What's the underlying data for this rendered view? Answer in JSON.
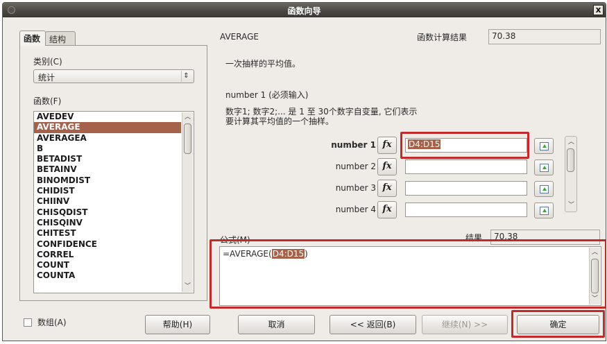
{
  "window": {
    "title": "函数向导",
    "close_glyph": "x"
  },
  "tabs": [
    {
      "label": "函数"
    },
    {
      "label": "结构"
    }
  ],
  "left": {
    "category_label": "类别(C)",
    "category_value": "统计",
    "function_label": "函数(F)",
    "functions": [
      "AVEDEV",
      "AVERAGE",
      "AVERAGEA",
      "B",
      "BETADIST",
      "BETAINV",
      "BINOMDIST",
      "CHIDIST",
      "CHIINV",
      "CHISQDIST",
      "CHISQINV",
      "CHITEST",
      "CONFIDENCE",
      "CORREL",
      "COUNT",
      "COUNTA"
    ],
    "selected_function": "AVERAGE"
  },
  "right": {
    "function_name": "AVERAGE",
    "function_result_label": "函数计算结果",
    "function_result_value": "70.38",
    "description": "一次抽样的平均值。",
    "argument_title": "number 1 (必须输入)",
    "argument_desc_line1": "数字1; 数字2;... 是 1 至 30个数字自变量, 它们表示",
    "argument_desc_line2": "要计算其平均值的一个抽样。",
    "arguments": [
      {
        "label": "number 1",
        "value": "D4:D15"
      },
      {
        "label": "number 2",
        "value": ""
      },
      {
        "label": "number 3",
        "value": ""
      },
      {
        "label": "number 4",
        "value": ""
      }
    ],
    "fx_glyph": "fx",
    "formula_label": "公式(M)",
    "result_label": "结果",
    "result_value": "70.38",
    "formula_prefix": "=AVERAGE(",
    "formula_highlight": "D4:D15",
    "formula_suffix": ")"
  },
  "bottom": {
    "array_label": "数组(A)",
    "help": "帮助(H)",
    "cancel": "取消",
    "back": "<< 返回(B)",
    "next": "继续(N) >>",
    "ok": "确定"
  },
  "colors": {
    "selection": "#a5614a",
    "highlight_box": "#c02a2a"
  }
}
